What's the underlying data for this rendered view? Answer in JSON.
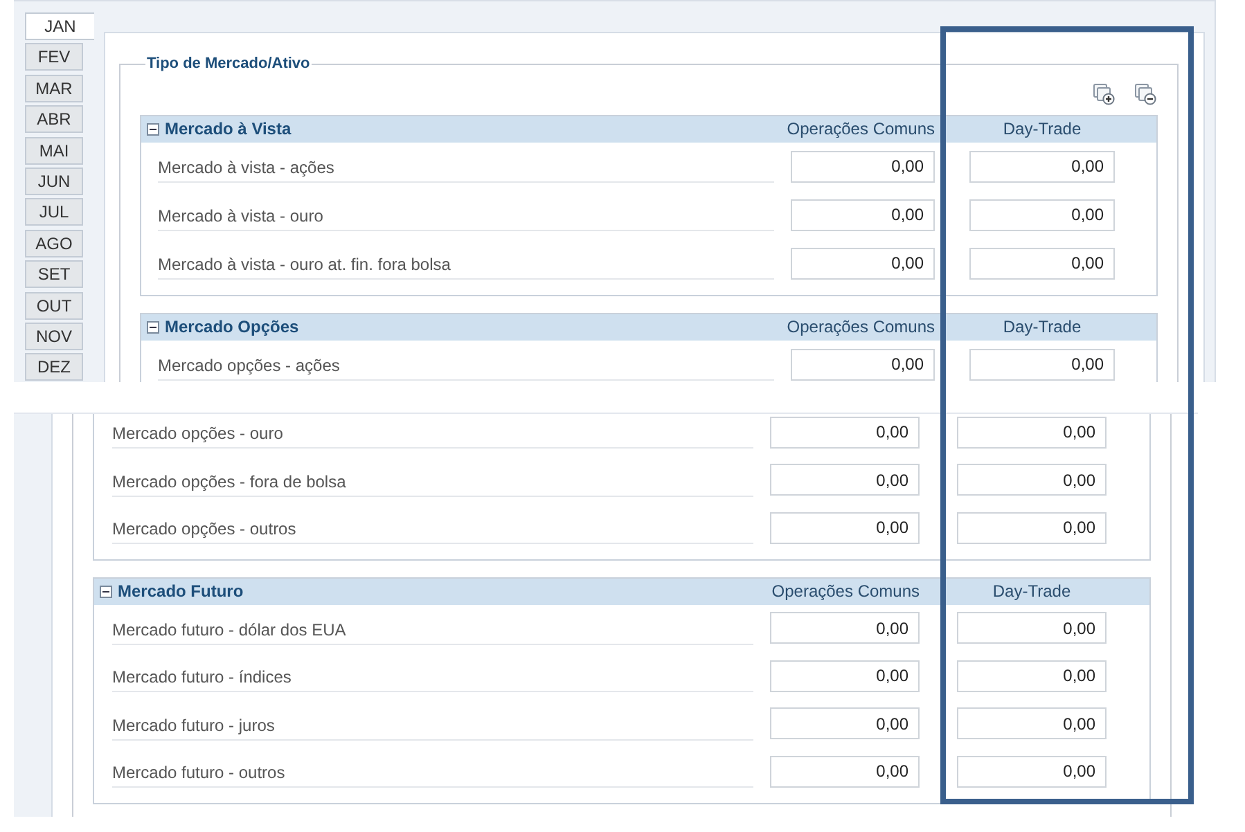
{
  "top_screenshot": {
    "months": [
      {
        "label": "JAN",
        "selected": true
      },
      {
        "label": "FEV",
        "selected": false
      },
      {
        "label": "MAR",
        "selected": false
      },
      {
        "label": "ABR",
        "selected": false
      },
      {
        "label": "MAI",
        "selected": false
      },
      {
        "label": "JUN",
        "selected": false
      },
      {
        "label": "JUL",
        "selected": false
      },
      {
        "label": "AGO",
        "selected": false
      },
      {
        "label": "SET",
        "selected": false
      },
      {
        "label": "OUT",
        "selected": false
      },
      {
        "label": "NOV",
        "selected": false
      },
      {
        "label": "DEZ",
        "selected": false
      }
    ],
    "legend": "Tipo de Mercado/Ativo",
    "sections": [
      {
        "title": "Mercado à Vista",
        "expanded": true,
        "columns": [
          "Operações Comuns",
          "Day-Trade"
        ],
        "rows": [
          {
            "label": "Mercado à vista - ações",
            "values": [
              "0,00",
              "0,00"
            ]
          },
          {
            "label": "Mercado à vista - ouro",
            "values": [
              "0,00",
              "0,00"
            ]
          },
          {
            "label": "Mercado à vista - ouro at. fin. fora bolsa",
            "values": [
              "0,00",
              "0,00"
            ]
          }
        ]
      },
      {
        "title": "Mercado Opções",
        "expanded": true,
        "columns": [
          "Operações Comuns",
          "Day-Trade"
        ],
        "rows": [
          {
            "label": "Mercado opções - ações",
            "values": [
              "0,00",
              "0,00"
            ]
          }
        ]
      }
    ]
  },
  "bottom_screenshot": {
    "sections": [
      {
        "rows": [
          {
            "label": "Mercado opções - ouro",
            "values": [
              "0,00",
              "0,00"
            ]
          },
          {
            "label": "Mercado opções - fora de bolsa",
            "values": [
              "0,00",
              "0,00"
            ]
          },
          {
            "label": "Mercado opções - outros",
            "values": [
              "0,00",
              "0,00"
            ]
          }
        ]
      },
      {
        "title": "Mercado Futuro",
        "expanded": true,
        "columns": [
          "Operações Comuns",
          "Day-Trade"
        ],
        "rows": [
          {
            "label": "Mercado futuro - dólar dos EUA",
            "values": [
              "0,00",
              "0,00"
            ]
          },
          {
            "label": "Mercado futuro - índices",
            "values": [
              "0,00",
              "0,00"
            ]
          },
          {
            "label": "Mercado futuro - juros",
            "values": [
              "0,00",
              "0,00"
            ]
          },
          {
            "label": "Mercado futuro - outros",
            "values": [
              "0,00",
              "0,00"
            ]
          }
        ]
      }
    ]
  }
}
